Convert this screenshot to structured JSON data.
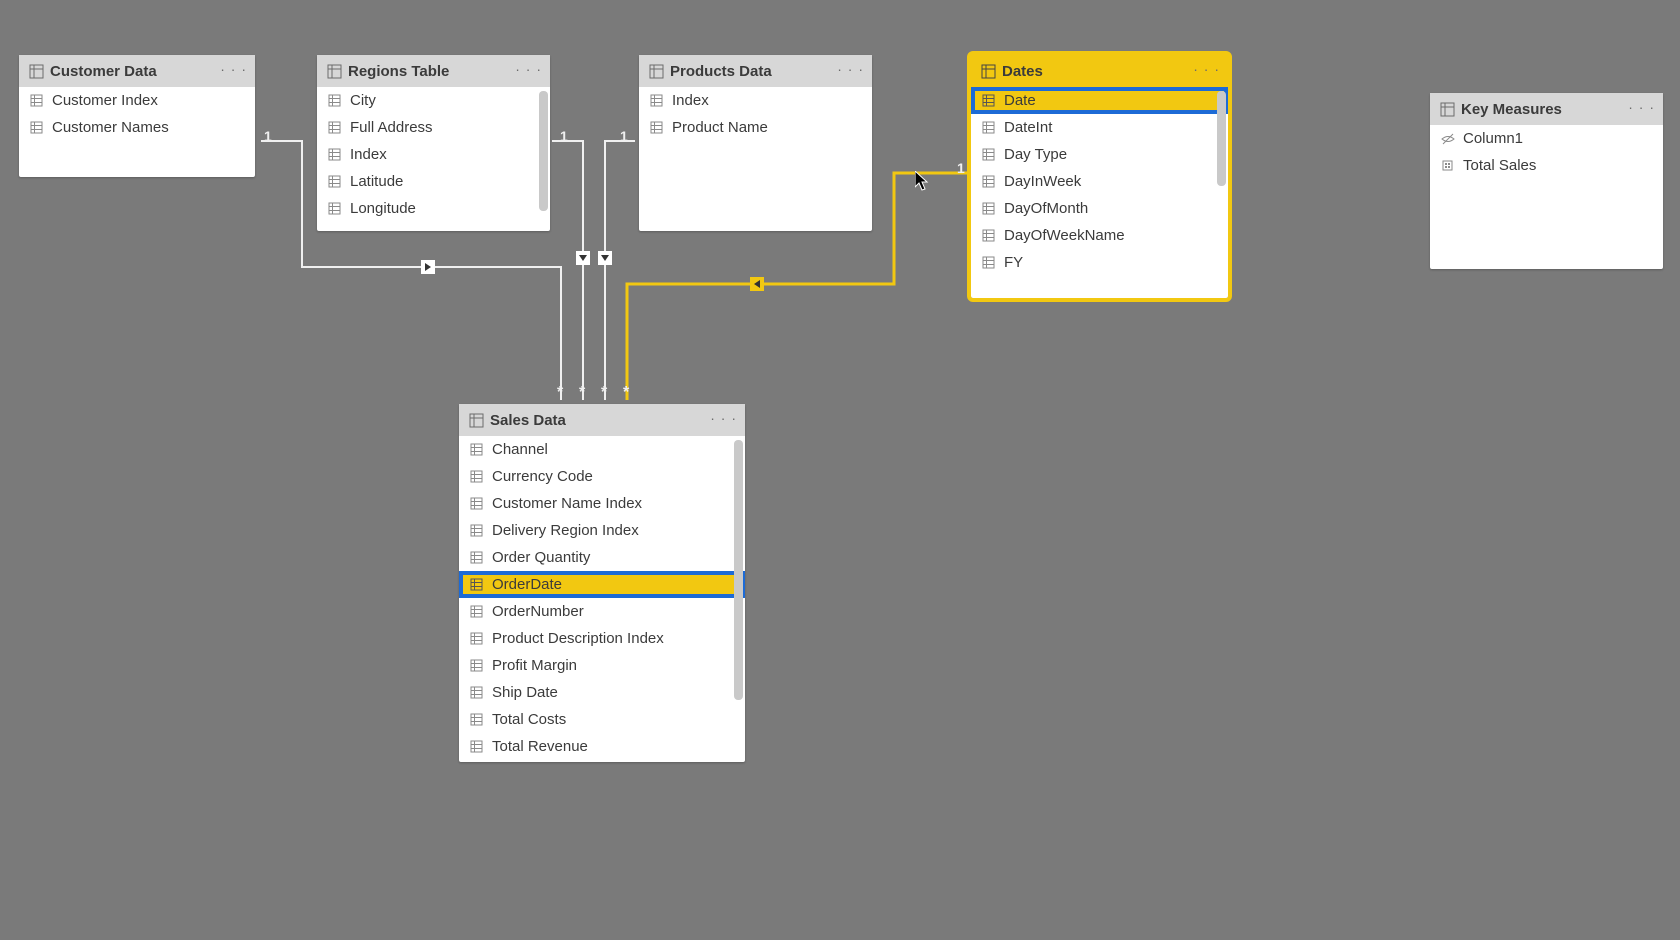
{
  "tables": {
    "customer": {
      "title": "Customer Data",
      "fields": [
        "Customer Index",
        "Customer Names"
      ]
    },
    "regions": {
      "title": "Regions Table",
      "fields": [
        "City",
        "Full Address",
        "Index",
        "Latitude",
        "Longitude"
      ]
    },
    "products": {
      "title": "Products Data",
      "fields": [
        "Index",
        "Product Name"
      ]
    },
    "dates": {
      "title": "Dates",
      "fields": [
        "Date",
        "DateInt",
        "Day Type",
        "DayInWeek",
        "DayOfMonth",
        "DayOfWeekName",
        "FY"
      ],
      "selected_field": "Date"
    },
    "measures": {
      "title": "Key Measures",
      "fields": [
        "Column1",
        "Total Sales"
      ],
      "field_kinds": [
        "hidden",
        "measure"
      ]
    },
    "sales": {
      "title": "Sales Data",
      "fields": [
        "Channel",
        "Currency Code",
        "Customer Name Index",
        "Delivery Region Index",
        "Order Quantity",
        "OrderDate",
        "OrderNumber",
        "Product Description Index",
        "Profit Margin",
        "Ship Date",
        "Total Costs",
        "Total Revenue"
      ],
      "selected_field": "OrderDate"
    }
  },
  "cardinality": {
    "one": "1",
    "many": "*"
  }
}
